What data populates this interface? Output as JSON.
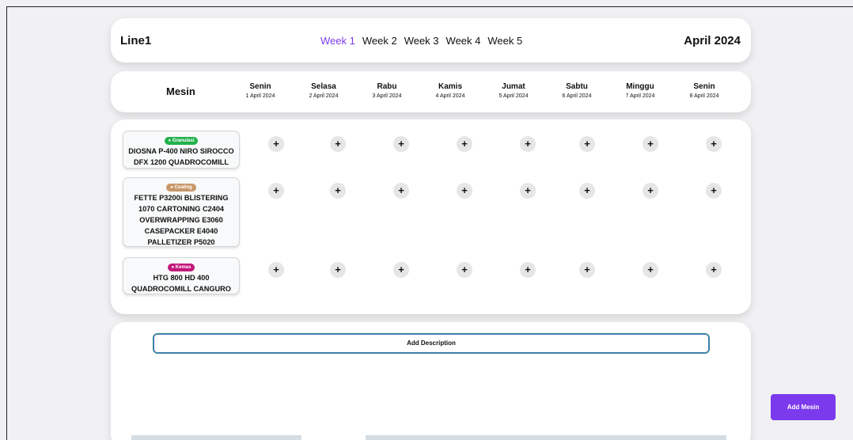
{
  "header": {
    "line_title": "Line1",
    "weeks": [
      "Week 1",
      "Week 2",
      "Week 3",
      "Week 4",
      "Week 5"
    ],
    "active_week": "Week 1",
    "month_title": "April 2024"
  },
  "day_header": {
    "mesin_label": "Mesin",
    "days": [
      {
        "name": "Senin",
        "date": "1 April 2024"
      },
      {
        "name": "Selasa",
        "date": "2 April 2024"
      },
      {
        "name": "Rabu",
        "date": "3 April 2024"
      },
      {
        "name": "Kamis",
        "date": "4 April 2024"
      },
      {
        "name": "Jumat",
        "date": "5 April 2024"
      },
      {
        "name": "Sabtu",
        "date": "6 April 2024"
      },
      {
        "name": "Minggu",
        "date": "7 April 2024"
      },
      {
        "name": "Senin",
        "date": "8 April 2024"
      }
    ]
  },
  "machines": [
    {
      "badge": "● Granulasi",
      "badge_color": "#22b14c",
      "lines": [
        "DIOSNA P-400 NIRO SIROCCO",
        "DFX 1200 QUADROCOMILL"
      ]
    },
    {
      "badge": "● Coating",
      "badge_color": "#c9986a",
      "lines": [
        "FETTE P3200i BLISTERING",
        "1070 CARTONING C2404",
        "OVERWRAPPING E3060",
        "CASEPACKER E4040",
        "PALLETIZER P5020"
      ]
    },
    {
      "badge": "● Kemas",
      "badge_color": "#c2187a",
      "lines": [
        "HTG 800 HD 400",
        "QUADROCOMILL CANGURO"
      ]
    }
  ],
  "add_slot_symbol": "+",
  "description": {
    "button_label": "Add Description"
  },
  "add_mesin_label": "Add Mesin",
  "colors": {
    "accent": "#7c3aed",
    "background": "#f1f1f3"
  }
}
